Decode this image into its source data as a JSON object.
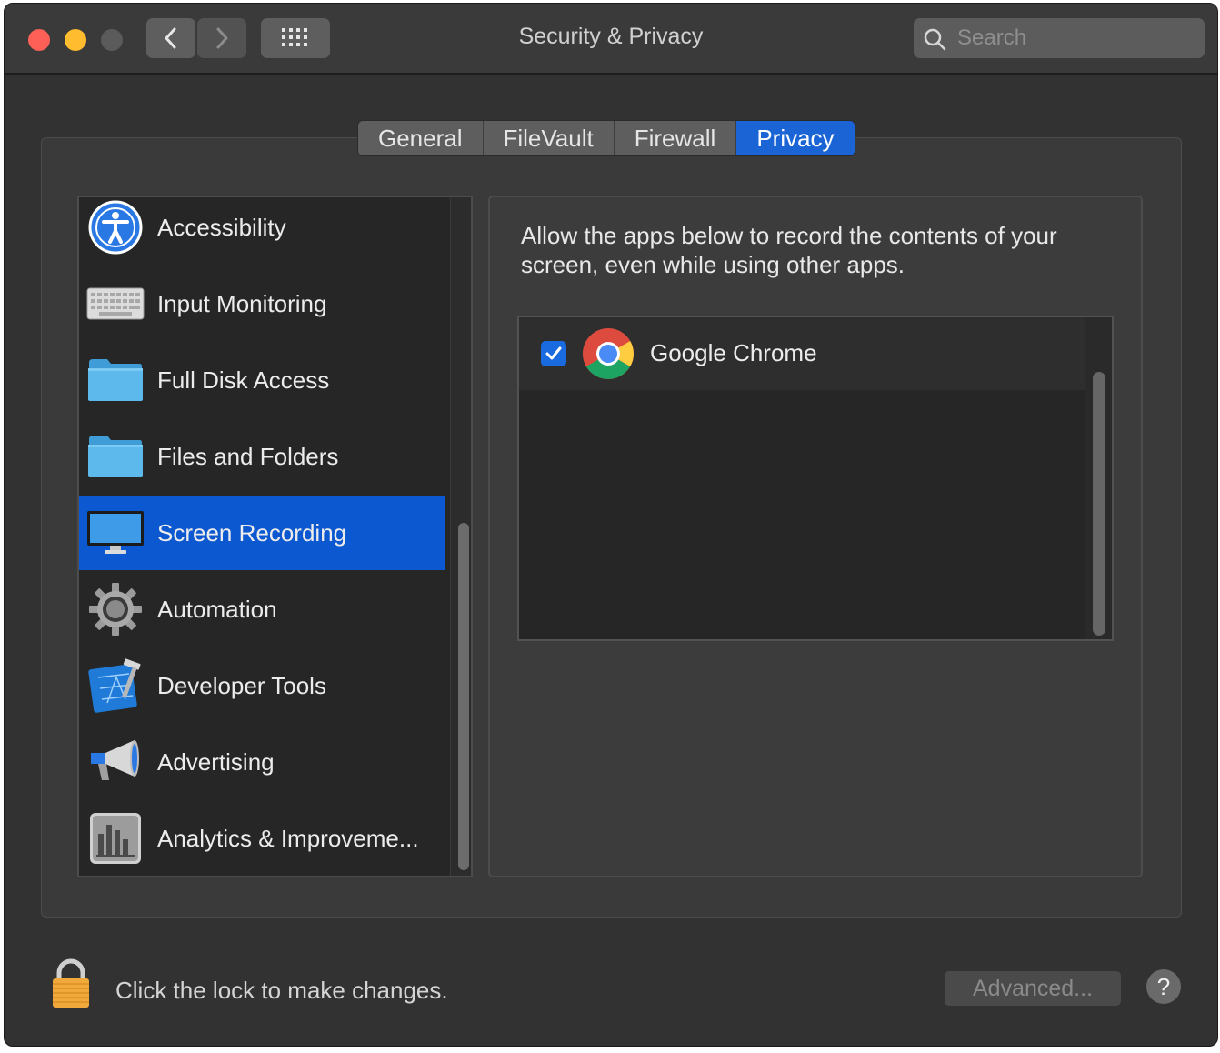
{
  "window": {
    "title": "Security & Privacy"
  },
  "search": {
    "placeholder": "Search"
  },
  "tabs": [
    {
      "label": "General"
    },
    {
      "label": "FileVault"
    },
    {
      "label": "Firewall"
    },
    {
      "label": "Privacy",
      "active": true
    }
  ],
  "sidebar": {
    "items": [
      {
        "label": "Accessibility",
        "icon": "accessibility-icon"
      },
      {
        "label": "Input Monitoring",
        "icon": "keyboard-icon"
      },
      {
        "label": "Full Disk Access",
        "icon": "folder-icon"
      },
      {
        "label": "Files and Folders",
        "icon": "folder-icon"
      },
      {
        "label": "Screen Recording",
        "icon": "display-icon",
        "selected": true
      },
      {
        "label": "Automation",
        "icon": "gear-icon"
      },
      {
        "label": "Developer Tools",
        "icon": "xcode-icon"
      },
      {
        "label": "Advertising",
        "icon": "megaphone-icon"
      },
      {
        "label": "Analytics & Improveme...",
        "icon": "analytics-icon"
      }
    ]
  },
  "panel": {
    "description": "Allow the apps below to record the contents of your screen, even while using other apps.",
    "apps": [
      {
        "name": "Google Chrome",
        "checked": true,
        "icon": "chrome-icon"
      }
    ]
  },
  "footer": {
    "lock_text": "Click the lock to make changes.",
    "advanced_label": "Advanced...",
    "help_label": "?"
  },
  "colors": {
    "accent": "#0c58d0",
    "background": "#323232",
    "list_background": "#262626"
  }
}
